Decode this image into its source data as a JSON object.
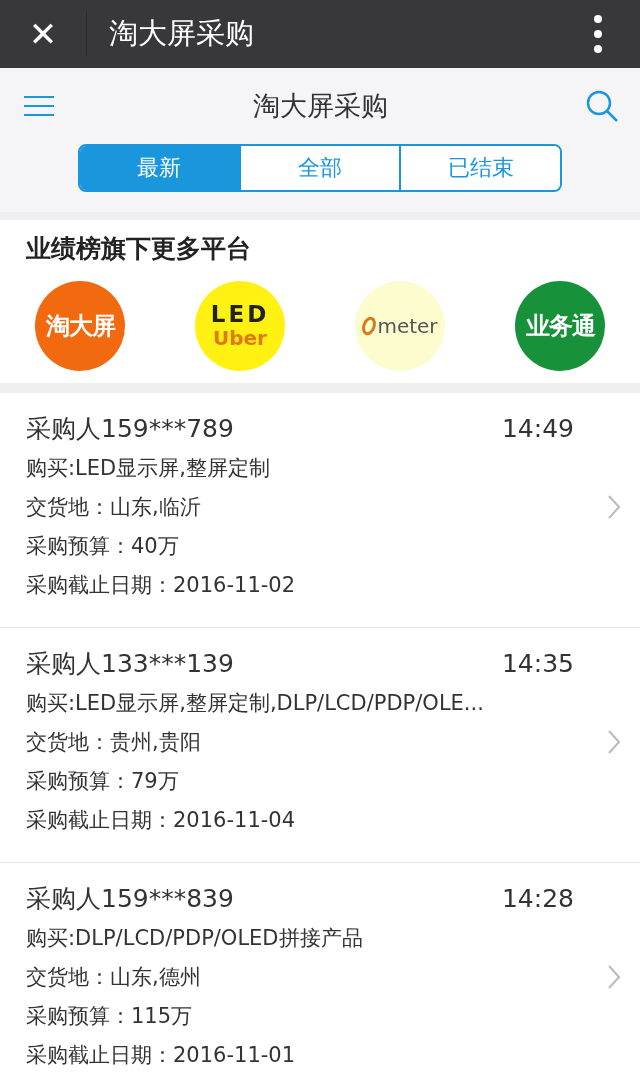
{
  "top_bar": {
    "close": "✕",
    "title": "淘大屏采购"
  },
  "header": {
    "title": "淘大屏采购"
  },
  "tabs": [
    {
      "label": "最新",
      "selected": true
    },
    {
      "label": "全部",
      "selected": false
    },
    {
      "label": "已结束",
      "selected": false
    }
  ],
  "platforms": {
    "title": "业绩榜旗下更多平台",
    "items": [
      {
        "kind": "cn",
        "color": "#f26a0f",
        "texts": [
          "淘大屏"
        ]
      },
      {
        "kind": "led",
        "color": "#fff212",
        "texts": [
          "LED",
          "Uber"
        ]
      },
      {
        "kind": "meter",
        "color": "#fdfccf",
        "texts": [
          "meter"
        ]
      },
      {
        "kind": "cn",
        "color": "#18923a",
        "texts": [
          "业务通"
        ]
      }
    ]
  },
  "orders": [
    {
      "buyer": "采购人159***789",
      "time": "14:49",
      "lines": [
        "购买:LED显示屏,整屏定制",
        "交货地：山东,临沂",
        "采购预算：40万",
        "采购截止日期：2016-11-02"
      ]
    },
    {
      "buyer": "采购人133***139",
      "time": "14:35",
      "lines": [
        "购买:LED显示屏,整屏定制,DLP/LCD/PDP/OLE...",
        "交货地：贵州,贵阳",
        "采购预算：79万",
        "采购截止日期：2016-11-04"
      ]
    },
    {
      "buyer": "采购人159***839",
      "time": "14:28",
      "lines": [
        "购买:DLP/LCD/PDP/OLED拼接产品",
        "交货地：山东,德州",
        "采购预算：115万",
        "采购截止日期：2016-11-01"
      ]
    }
  ]
}
